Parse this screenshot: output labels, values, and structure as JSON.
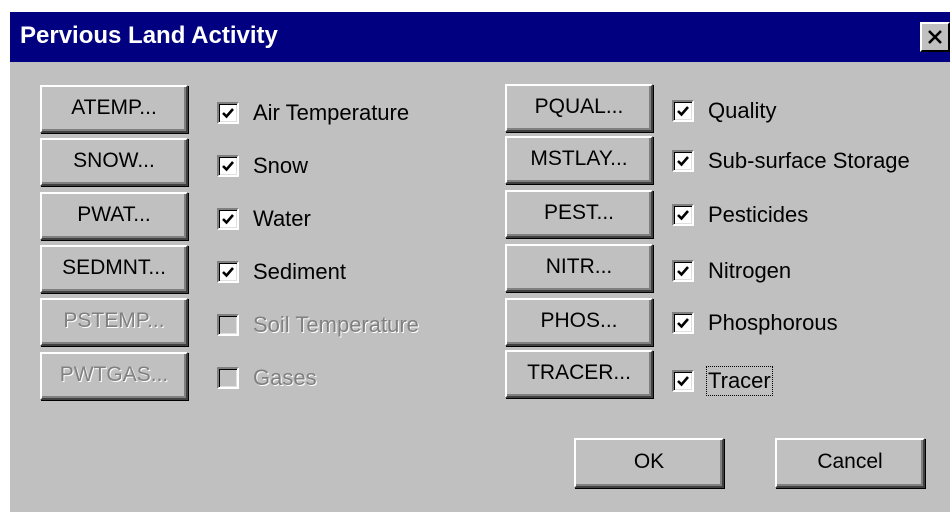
{
  "window": {
    "title": "Pervious Land Activity",
    "close_icon": "close-x-icon"
  },
  "left_column": [
    {
      "button": "ATEMP...",
      "label": "Air Temperature",
      "checked": true,
      "enabled": true
    },
    {
      "button": "SNOW...",
      "label": "Snow",
      "checked": true,
      "enabled": true
    },
    {
      "button": "PWAT...",
      "label": "Water",
      "checked": true,
      "enabled": true
    },
    {
      "button": "SEDMNT...",
      "label": "Sediment",
      "checked": true,
      "enabled": true
    },
    {
      "button": "PSTEMP...",
      "label": "Soil Temperature",
      "checked": false,
      "enabled": false
    },
    {
      "button": "PWTGAS...",
      "label": "Gases",
      "checked": false,
      "enabled": false
    }
  ],
  "right_column": [
    {
      "button": "PQUAL...",
      "label": "Quality",
      "checked": true,
      "enabled": true
    },
    {
      "button": "MSTLAY...",
      "label": "Sub-surface Storage",
      "checked": true,
      "enabled": true
    },
    {
      "button": "PEST...",
      "label": "Pesticides",
      "checked": true,
      "enabled": true
    },
    {
      "button": "NITR...",
      "label": "Nitrogen",
      "checked": true,
      "enabled": true
    },
    {
      "button": "PHOS...",
      "label": "Phosphorous",
      "checked": true,
      "enabled": true
    },
    {
      "button": "TRACER...",
      "label": "Tracer",
      "checked": true,
      "enabled": true,
      "focused": true
    }
  ],
  "footer": {
    "ok_label": "OK",
    "cancel_label": "Cancel"
  },
  "colors": {
    "titlebar": "#000080",
    "face": "#c0c0c0",
    "disabled_text": "#808080"
  }
}
